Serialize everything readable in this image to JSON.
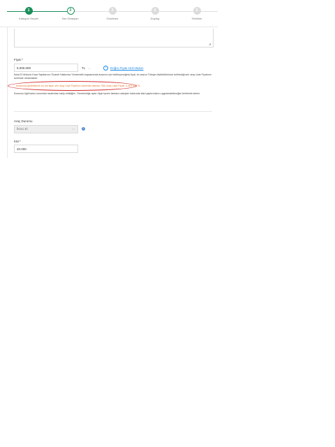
{
  "steps": [
    {
      "num": "1",
      "label": "Kategori Seçimi",
      "state": "done"
    },
    {
      "num": "2",
      "label": "İlan Detayları",
      "state": "active"
    },
    {
      "num": "3",
      "label": "Önizleme",
      "state": "todo"
    },
    {
      "num": "4",
      "label": "Doping",
      "state": "todo"
    },
    {
      "num": "5",
      "label": "Tebrikler",
      "state": "todo"
    }
  ],
  "textarea": {
    "resize_icon": "resize-grip-icon"
  },
  "price": {
    "label": "Fiyat *",
    "value": "5.000.000",
    "currency": "TL",
    "currency_icon": "chevron-down-icon",
    "link_text": "Doğru Fiyatı Hızlı Bulun",
    "legal_text": "İkinci El Motorlu Kara Taşıtlarının Ticareti Hakkında Yönetmelik kapsamında aracınız için belirleyeceğiniz fiyat, bu aracın Türkiye distribütörünün belirlediği sıfır araç Liste Fiyatının üzerinde olmamalıdır.",
    "warning": "Aracınıza girilebilecek en üst fiyat; sıfır araç Liste Fiyatının üzerinde olamaz. Sıfır Araç Liste Fiyatı: 3.403.000 TL",
    "info_text": "Konunun ilgili kamu kurumları tarafından takip edildiğini, Yönetmeliğe aykırı fiyat içeren ilanların satışları hakkında idari yaptırımların uygulanabileceğini belirtmek isteriz."
  },
  "vehicle_status": {
    "label": "Araç Durumu",
    "value": "İkinci El",
    "info_icon": "info-icon"
  },
  "km": {
    "label": "KM *",
    "value": "20.000"
  },
  "colors": {
    "accent": "#1b8f5b",
    "link": "#1e88e5",
    "warning": "#e8762a",
    "highlight": "#d32f2f"
  }
}
